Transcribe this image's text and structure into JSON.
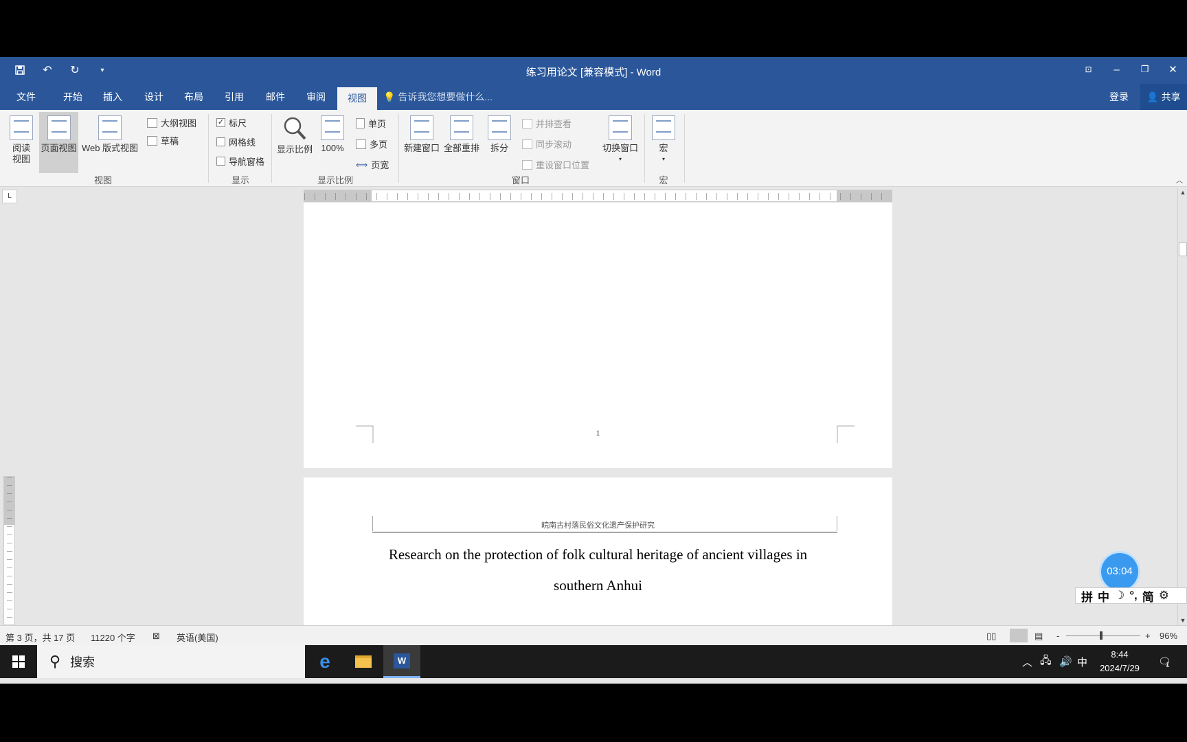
{
  "titlebar": {
    "doc_title": "练习用论文 [兼容模式] - Word"
  },
  "tabs": {
    "file": "文件",
    "home": "开始",
    "insert": "插入",
    "design": "设计",
    "layout": "布局",
    "references": "引用",
    "mailings": "邮件",
    "review": "审阅",
    "view": "视图",
    "tell_me": "告诉我您想要做什么...",
    "login": "登录",
    "share": "共享"
  },
  "ribbon": {
    "views": {
      "read_mode": "阅读视图",
      "print_layout": "页面视图",
      "web_layout": "Web 版式视图",
      "outline": "大纲视图",
      "draft": "草稿",
      "group": "视图"
    },
    "show": {
      "ruler": "标尺",
      "gridlines": "网格线",
      "nav_pane": "导航窗格",
      "group": "显示"
    },
    "zoom": {
      "zoom": "显示比例",
      "hundred": "100%",
      "one_page": "单页",
      "multi_page": "多页",
      "page_width": "页宽",
      "group": "显示比例"
    },
    "window": {
      "new_window": "新建窗口",
      "arrange_all": "全部重排",
      "split": "拆分",
      "side_by_side": "并排查看",
      "sync_scroll": "同步滚动",
      "reset_pos": "重设窗口位置",
      "switch": "切换窗口",
      "group": "窗口"
    },
    "macros": {
      "macros": "宏",
      "group": "宏"
    }
  },
  "document": {
    "page_number": "1",
    "header_text": "皖南古村落民俗文化遗产保护研究",
    "title_line1": "Research on the protection of folk cultural heritage of ancient villages in",
    "title_line2": "southern Anhui"
  },
  "overlay": {
    "timer": "03:04",
    "ime": [
      "拼",
      "中",
      "简"
    ]
  },
  "statusbar": {
    "page_info": "第 3 页，共 17 页",
    "word_count": "11220 个字",
    "language": "英语(美国)",
    "zoom_minus": "-",
    "zoom_plus": "+",
    "zoom_level": "96%"
  },
  "taskbar": {
    "search": "搜索",
    "ime": "中",
    "time": "8:44",
    "date": "2024/7/29",
    "notifications": "1"
  },
  "colors": {
    "word_blue": "#2b579a",
    "ribbon_bg": "#f3f3f3",
    "timer_blue": "#3a9af0"
  }
}
